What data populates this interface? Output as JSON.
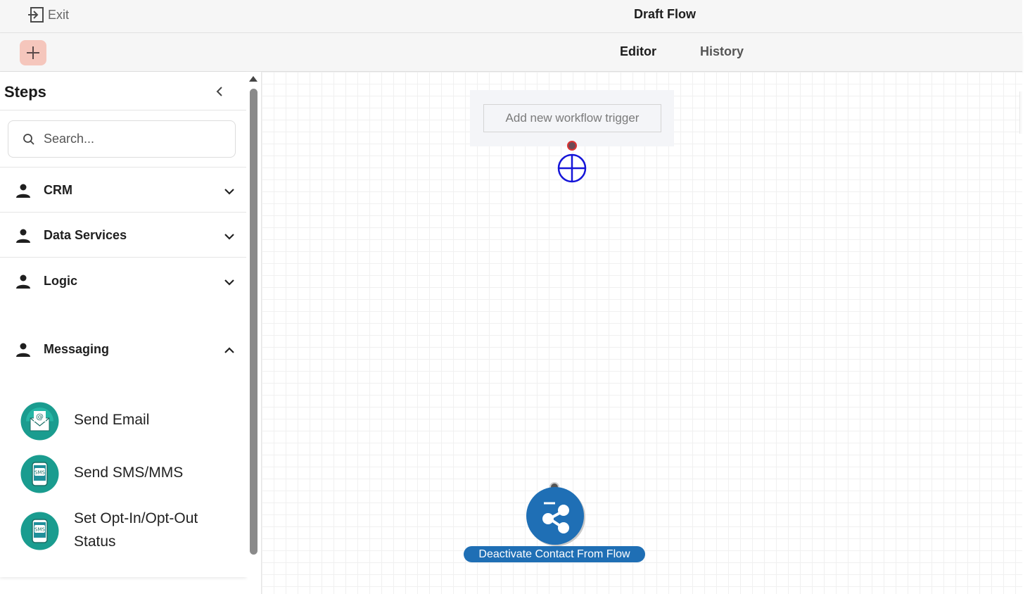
{
  "header": {
    "exit_label": "Exit",
    "title": "Draft Flow"
  },
  "tabs": {
    "editor": "Editor",
    "history": "History",
    "active": "Editor"
  },
  "sidebar": {
    "title": "Steps",
    "search_placeholder": "Search...",
    "categories": [
      {
        "label": "CRM",
        "expanded": false
      },
      {
        "label": "Data Services",
        "expanded": false
      },
      {
        "label": "Logic",
        "expanded": false
      },
      {
        "label": "Messaging",
        "expanded": true
      }
    ],
    "messaging_actions": [
      {
        "label": "Send Email",
        "icon": "email-icon"
      },
      {
        "label": "Send SMS/MMS",
        "icon": "sms-icon"
      },
      {
        "label_line1": "Set Opt-In/Opt-Out",
        "label_line2": "Status",
        "icon": "sms-icon"
      }
    ]
  },
  "canvas": {
    "trigger_label": "Add new workflow trigger",
    "node_label": "Deactivate Contact From Flow"
  },
  "colors": {
    "accent": "#e3542f",
    "add_button": "#f5c6bc",
    "node_blue": "#1f6fb5",
    "teal_icon": "#1a9c8f"
  }
}
